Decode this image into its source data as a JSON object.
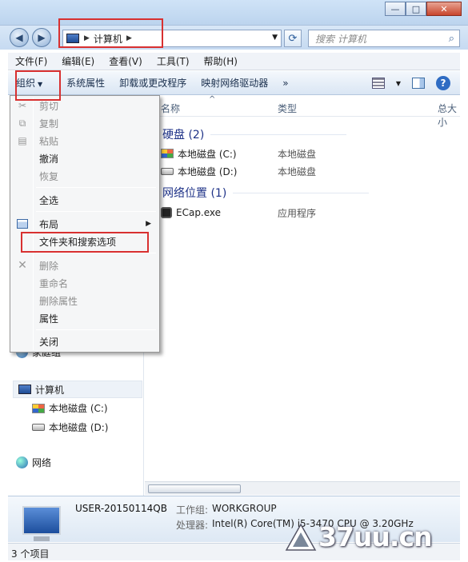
{
  "window": {
    "min_glyph": "—",
    "max_glyph": "□",
    "close_glyph": "✕"
  },
  "nav": {
    "back_glyph": "◀",
    "forward_glyph": "▶",
    "address_crumb": "计算机",
    "crumb_sep": "▶",
    "dropdown_glyph": "▼",
    "refresh_glyph": "⟳",
    "search_placeholder": "搜索 计算机",
    "search_glyph": "⌕"
  },
  "menubar": [
    "文件(F)",
    "编辑(E)",
    "查看(V)",
    "工具(T)",
    "帮助(H)"
  ],
  "commandbar": {
    "organize": "组织",
    "organize_tri": "▼",
    "system_props": "系统属性",
    "uninstall": "卸载或更改程序",
    "map_drive": "映射网络驱动器",
    "more": "»",
    "views_tri": "▼",
    "help": "?"
  },
  "columns": {
    "name": "名称",
    "type": "类型",
    "size": "总大小",
    "sort_glyph": "^"
  },
  "groups": {
    "hdd": "硬盘 (2)",
    "net": "网络位置 (1)"
  },
  "items": [
    {
      "name": "本地磁盘 (C:)",
      "type": "本地磁盘"
    },
    {
      "name": "本地磁盘 (D:)",
      "type": "本地磁盘"
    },
    {
      "name": "ECap.exe",
      "type": "应用程序"
    }
  ],
  "leftnav": {
    "homegroup": "家庭组",
    "computer": "计算机",
    "drive_c": "本地磁盘 (C:)",
    "drive_d": "本地磁盘 (D:)",
    "network": "网络"
  },
  "organize_menu": {
    "cut": "剪切",
    "copy": "复制",
    "paste": "粘贴",
    "undo": "撤消",
    "redo": "恢复",
    "select_all": "全选",
    "layout": "布局",
    "folder_options": "文件夹和搜索选项",
    "delete": "删除",
    "rename": "重命名",
    "remove_props": "删除属性",
    "properties": "属性",
    "close": "关闭",
    "submenu_glyph": "▶"
  },
  "details": {
    "computer_name": "USER-20150114QB",
    "workgroup_label": "工作组:",
    "workgroup": "WORKGROUP",
    "cpu_label": "处理器:",
    "cpu": "Intel(R) Core(TM) i5-3470 CPU @ 3.20GHz"
  },
  "status": {
    "count": "3 个项目"
  },
  "watermark": "37uu.cn"
}
